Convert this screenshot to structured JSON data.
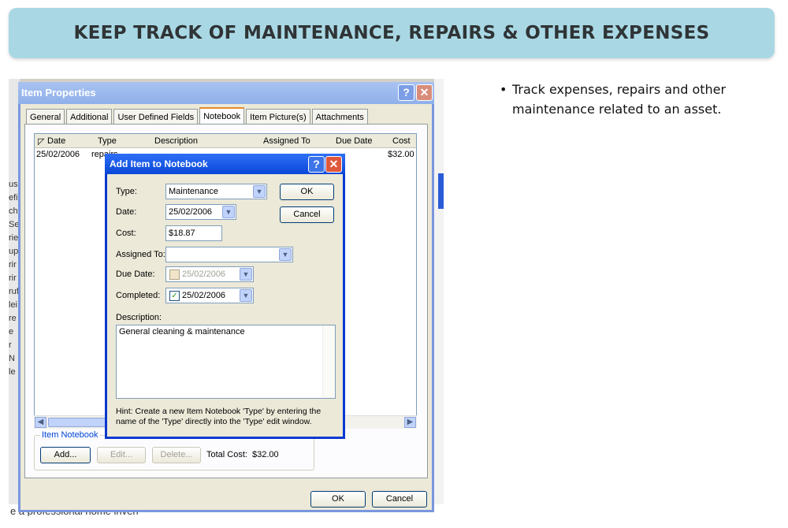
{
  "banner": {
    "title": "KEEP TRACK OF MAINTENANCE, REPAIRS & OTHER EXPENSES"
  },
  "bullets": [
    "Track expenses, repairs and other maintenance related to an asset."
  ],
  "item_properties": {
    "title": "Item Properties",
    "help_glyph": "?",
    "close_glyph": "✕",
    "tabs": [
      "General",
      "Additional",
      "User Defined Fields",
      "Notebook",
      "Item Picture(s)",
      "Attachments"
    ],
    "active_tab": "Notebook",
    "grid": {
      "columns": [
        "Date",
        "Type",
        "Description",
        "Assigned To",
        "Due Date",
        "Cost"
      ],
      "rows": [
        {
          "date": "25/02/2006",
          "type": "repairs",
          "cost": "$32.00"
        }
      ]
    },
    "group_label": "Item Notebook",
    "add_label": "Add...",
    "edit_label": "Edit...",
    "delete_label": "Delete...",
    "total_cost_label": "Total Cost:",
    "total_cost_value": "$32.00",
    "ok_label": "OK",
    "cancel_label": "Cancel"
  },
  "add_item_dialog": {
    "title": "Add Item to Notebook",
    "help_glyph": "?",
    "close_glyph": "✕",
    "type_label": "Type:",
    "type_value": "Maintenance",
    "date_label": "Date:",
    "date_value": "25/02/2006",
    "cost_label": "Cost:",
    "cost_value": "$18.87",
    "assigned_label": "Assigned To:",
    "assigned_value": "",
    "due_label": "Due Date:",
    "due_value": "25/02/2006",
    "due_checked": false,
    "completed_label": "Completed:",
    "completed_value": "25/02/2006",
    "completed_checked": true,
    "description_label": "Description:",
    "description_value": "General cleaning & maintenance",
    "hint": "Hint: Create a new Item Notebook 'Type' by entering the name of the 'Type' directly into the 'Type' edit window.",
    "ok_label": "OK",
    "cancel_label": "Cancel"
  },
  "background_fragments": {
    "bottom_text": "e a professional home inven",
    "left_letters": [
      "us",
      "efi",
      "ch",
      "Se",
      "rie",
      "up",
      "rir",
      "rir",
      "ruf",
      "lei",
      "re",
      "e",
      "r N",
      "le"
    ]
  },
  "colors": {
    "banner_bg": "#a9d8e4",
    "dialog_title_bg": "#0a47d8",
    "window_title_bg": "#8fb0ea"
  }
}
